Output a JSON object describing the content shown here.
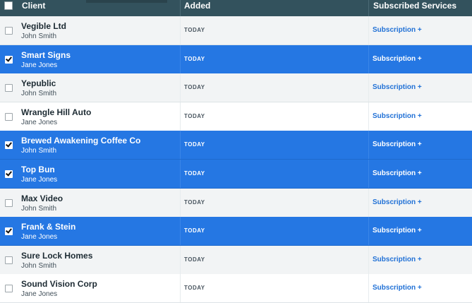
{
  "header": {
    "col_client": "Client",
    "col_added": "Added",
    "col_services": "Subscribed Services"
  },
  "rows": [
    {
      "name": "Vegible Ltd",
      "owner": "John Smith",
      "added": "TODAY",
      "services": "Subscription +",
      "checked": false
    },
    {
      "name": "Smart Signs",
      "owner": "Jane Jones",
      "added": "TODAY",
      "services": "Subscription +",
      "checked": true
    },
    {
      "name": "Yepublic",
      "owner": "John Smith",
      "added": "TODAY",
      "services": "Subscription +",
      "checked": false
    },
    {
      "name": "Wrangle Hill Auto",
      "owner": "Jane Jones",
      "added": "TODAY",
      "services": "Subscription +",
      "checked": false
    },
    {
      "name": "Brewed Awakening Coffee Co",
      "owner": "John Smith",
      "added": "TODAY",
      "services": "Subscription +",
      "checked": true
    },
    {
      "name": "Top Bun",
      "owner": "Jane Jones",
      "added": "TODAY",
      "services": "Subscription +",
      "checked": true
    },
    {
      "name": "Max Video",
      "owner": "John Smith",
      "added": "TODAY",
      "services": "Subscription +",
      "checked": false
    },
    {
      "name": "Frank & Stein",
      "owner": "Jane Jones",
      "added": "TODAY",
      "services": "Subscription +",
      "checked": true
    },
    {
      "name": "Sure Lock Homes",
      "owner": "John Smith",
      "added": "TODAY",
      "services": "Subscription +",
      "checked": false
    },
    {
      "name": "Sound Vision Corp",
      "owner": "Jane Jones",
      "added": "TODAY",
      "services": "Subscription +",
      "checked": false
    }
  ],
  "colors": {
    "header_bg": "#33525d",
    "selected_row": "#2577e3",
    "link": "#2171d6"
  }
}
